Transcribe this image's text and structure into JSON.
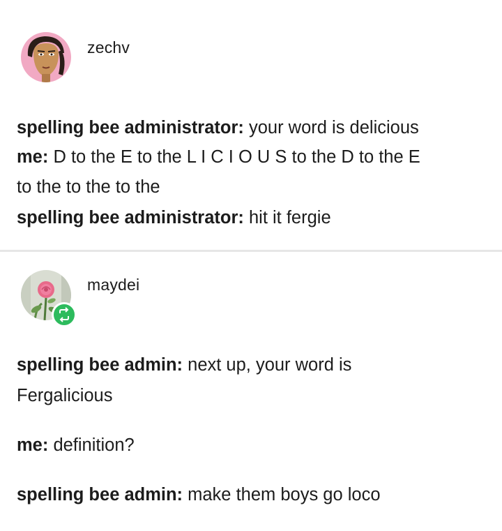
{
  "post1": {
    "username": "zechv",
    "avatar_icon": "avatar-illustrated-face-icon",
    "lines": [
      {
        "speaker": "spelling bee administrator:",
        "text": " your word is delicious"
      },
      {
        "speaker": "me:",
        "text": " D to the E to the L I C I O U S to the D to the E"
      },
      {
        "speaker": "",
        "text": "to the to the to the"
      },
      {
        "speaker": "spelling bee administrator:",
        "text": " hit it fergie"
      }
    ]
  },
  "post2": {
    "username": "maydei",
    "avatar_icon": "avatar-rose-flower-icon",
    "reblog_icon": "reblog-icon",
    "lines": [
      {
        "speaker": "spelling bee admin:",
        "text": " next up, your word is"
      },
      {
        "speaker": "",
        "text": "Fergalicious"
      },
      {
        "speaker": "me:",
        "text": " definition?"
      },
      {
        "speaker": "spelling bee admin:",
        "text": " make them boys go loco"
      }
    ]
  },
  "colors": {
    "text": "#1c1c1c",
    "divider": "#e6e6e6",
    "reblog_badge": "#2dbb5d"
  }
}
